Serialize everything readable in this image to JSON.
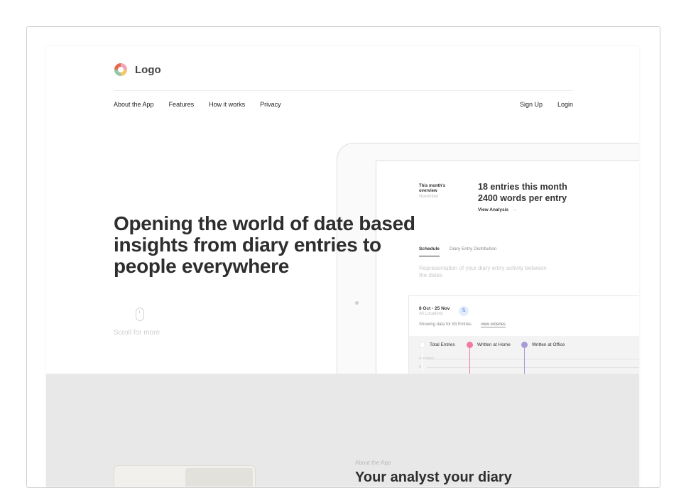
{
  "logo": {
    "text": "Logo"
  },
  "nav": {
    "left": [
      "About the App",
      "Features",
      "How it works",
      "Privacy"
    ],
    "right": [
      "Sign Up",
      "Login"
    ]
  },
  "hero": {
    "title": "Opening the world of date based insights from diary entries to people everywhere",
    "scroll_text": "Scroll for more"
  },
  "dashboard": {
    "overview_label": "This month's overview",
    "overview_month": "November",
    "stat_entries": "18 entries this month",
    "stat_words": "2400 words per entry",
    "view_analysis": "View Analysis",
    "tabs": [
      "Schedule",
      "Diary Entry Distribution"
    ],
    "description": "Representation of your diary entry activity between the dates",
    "date_range": "8 Oct - 25 Nov",
    "locations": "All Locations",
    "showing": "Showing data for 83 Entries",
    "view_entries": "view enteries",
    "legend": [
      {
        "label": "Total Entries",
        "color": "#ffffff"
      },
      {
        "label": "Written at Home",
        "color": "#f07aa0"
      },
      {
        "label": "Written at Office",
        "color": "#a99bd8"
      }
    ],
    "grid_labels": [
      "6 entries",
      "5"
    ]
  },
  "about": {
    "small": "About the App",
    "title": "Your analyst your diary"
  }
}
